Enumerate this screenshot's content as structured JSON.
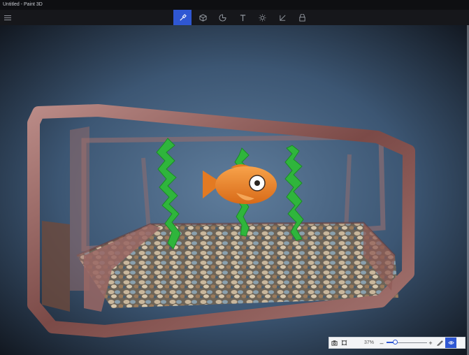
{
  "window": {
    "title": "Untitled - Paint 3D"
  },
  "toolbar": {
    "tools": [
      {
        "name": "brushes",
        "icon": "brush-icon",
        "active": true
      },
      {
        "name": "3d-shapes",
        "icon": "cube-icon",
        "active": false
      },
      {
        "name": "stickers",
        "icon": "sticker-icon",
        "active": false
      },
      {
        "name": "text",
        "icon": "text-icon",
        "active": false
      },
      {
        "name": "effects",
        "icon": "sun-icon",
        "active": false
      },
      {
        "name": "canvas",
        "icon": "crop-icon",
        "active": false
      },
      {
        "name": "3d-library",
        "icon": "library-icon",
        "active": false
      }
    ],
    "accent": "#2f57d3"
  },
  "zoom": {
    "value": "37%",
    "level": 0.2,
    "minus": "–",
    "plus": "+"
  },
  "scene": {
    "background": "#314a67",
    "fish_color": "#f08a2a",
    "seaweed_color": "#2fb53c",
    "tank_color": "#8e5a55"
  }
}
